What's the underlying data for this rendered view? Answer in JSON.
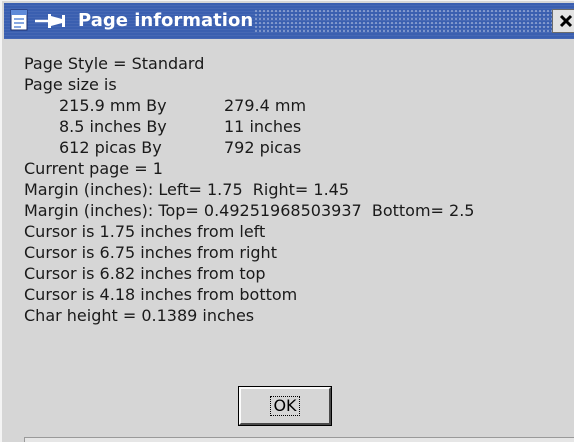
{
  "window": {
    "title": "Page information"
  },
  "icons": {
    "app": "document-icon",
    "pin": "pin-icon",
    "close": "close-icon"
  },
  "info": {
    "page_style": "Page Style = Standard",
    "page_size_heading": "Page size is",
    "size_mm": [
      "215.9 mm By",
      "279.4 mm"
    ],
    "size_inches": [
      "8.5 inches By",
      "11 inches"
    ],
    "size_picas": [
      "612 picas By",
      "792 picas"
    ],
    "current_page": "Current page = 1",
    "margin_lr": "Margin (inches): Left= 1.75  Right= 1.45",
    "margin_tb": "Margin (inches): Top= 0.49251968503937  Bottom= 2.5",
    "cursor_left": "Cursor is 1.75 inches from left",
    "cursor_right": "Cursor is 6.75 inches from right",
    "cursor_top": "Cursor is 6.82 inches from top",
    "cursor_bottom": "Cursor is 4.18 inches from bottom",
    "char_height": "Char height = 0.1389 inches"
  },
  "buttons": {
    "ok_label": "OK"
  },
  "colors": {
    "titlebar": "#3a5fb0",
    "window_bg": "#d6d6d6",
    "text": "#1a1a1a"
  }
}
